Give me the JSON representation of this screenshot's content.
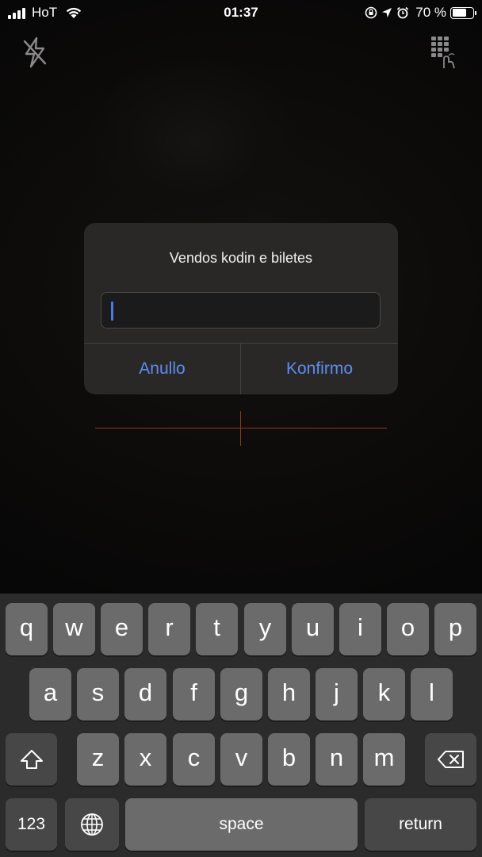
{
  "status_bar": {
    "carrier": "HoT",
    "time": "01:37",
    "battery_percent": "70 %",
    "battery_level": 0.7
  },
  "toolbar": {
    "flash_icon": "flash-off-icon",
    "keypad_icon": "manual-entry-keypad-icon"
  },
  "dialog": {
    "title": "Vendos kodin e biletes",
    "input_value": "",
    "cancel_label": "Anullo",
    "confirm_label": "Konfirmo",
    "accent_color": "#5a8ef2"
  },
  "keyboard": {
    "row1": [
      "q",
      "w",
      "e",
      "r",
      "t",
      "y",
      "u",
      "i",
      "o",
      "p"
    ],
    "row2": [
      "a",
      "s",
      "d",
      "f",
      "g",
      "h",
      "j",
      "k",
      "l"
    ],
    "row3": [
      "z",
      "x",
      "c",
      "v",
      "b",
      "n",
      "m"
    ],
    "numbers_label": "123",
    "space_label": "space",
    "return_label": "return",
    "shift_icon": "shift-icon",
    "delete_icon": "delete-icon",
    "globe_icon": "globe-icon"
  }
}
